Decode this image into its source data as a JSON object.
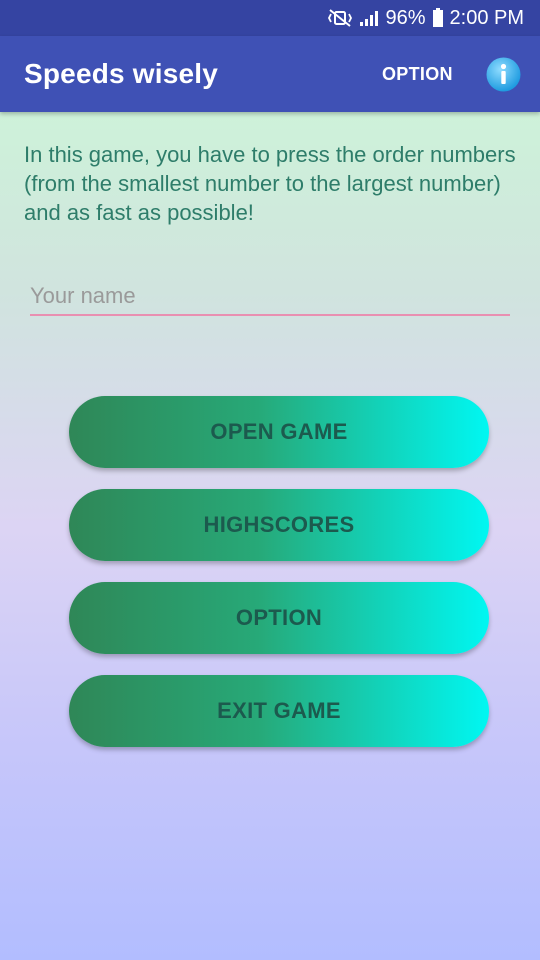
{
  "status_bar": {
    "battery": "96%",
    "time": "2:00 PM",
    "icons": [
      "vibrate-mute-icon",
      "signal-icon",
      "battery-icon"
    ]
  },
  "app_bar": {
    "title": "Speeds wisely",
    "option_label": "OPTION",
    "info_icon": "info-icon"
  },
  "intro_text": "In this game, you have to press the order numbers (from the smallest number to the largest number) and as fast as possible!",
  "name_input": {
    "placeholder": "Your name",
    "value": ""
  },
  "menu": {
    "open_game": "OPEN GAME",
    "highscores": "HIGHSCORES",
    "option": "OPTION",
    "exit_game": "EXIT GAME"
  },
  "colors": {
    "status_bar": "#3544a2",
    "app_bar": "#3f51b5",
    "intro_text": "#2e7d6a",
    "button_start": "#2f8757",
    "button_end": "#00f7f2",
    "button_text": "#1c5a4e",
    "input_underline": "#e98fb1"
  }
}
